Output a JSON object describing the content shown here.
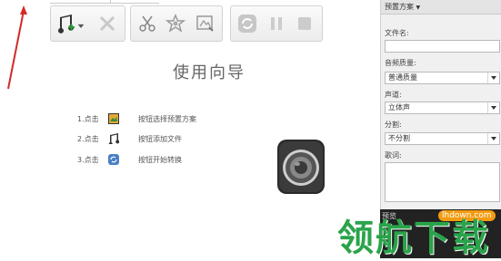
{
  "guide": {
    "title": "使用向导",
    "steps": [
      {
        "num": "1.点击",
        "icon": "preset-icon",
        "text": "按钮选择预置方案"
      },
      {
        "num": "2.点击",
        "icon": "add-music-icon",
        "text": "按钮添加文件"
      },
      {
        "num": "3.点击",
        "icon": "convert-icon",
        "text": "按钮开始转换"
      }
    ]
  },
  "toolbar": {
    "buttons": [
      "add-music-icon",
      "dropdown-arrow-icon",
      "delete-icon",
      "cut-icon",
      "effects-icon",
      "edit-icon",
      "convert-icon",
      "pause-icon",
      "stop-icon"
    ]
  },
  "panel": {
    "header": "预置方案",
    "filename_label": "文件名:",
    "filename_value": "",
    "quality_label": "音频质量:",
    "quality_value": "普通质量",
    "channel_label": "声道:",
    "channel_value": "立体声",
    "split_label": "分割:",
    "split_value": "不分割",
    "lyrics_label": "歌词:",
    "preview_label": "预览"
  },
  "watermark": {
    "text": "领航下载",
    "url": "lhdown.com"
  },
  "colors": {
    "annotation": "#d32b2b",
    "watermark_green": "#2aa34a",
    "watermark_badge": "#f39c12"
  }
}
